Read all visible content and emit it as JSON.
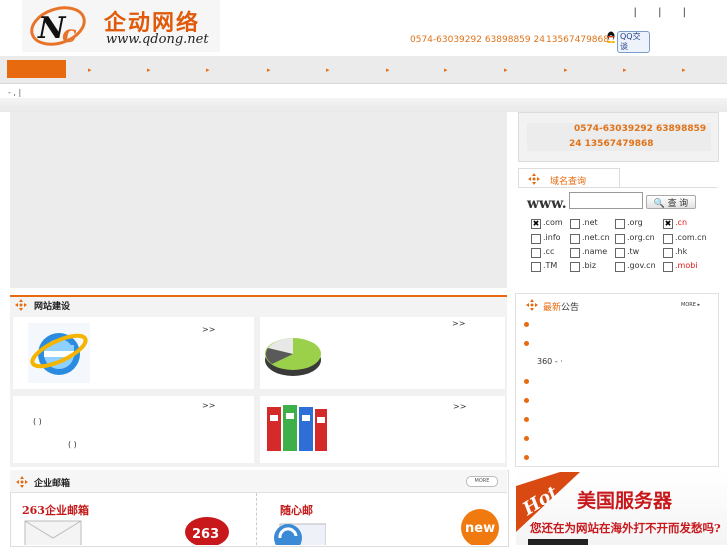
{
  "header": {
    "logo_cn": "企动网络",
    "logo_url": "www.qdong.net",
    "top_links": "| | |",
    "phone_line1": "0574-63039292 63898859 24",
    "phone_line2": "13567479868",
    "qq_label": "QQ交谈"
  },
  "nav": {
    "items": [
      "",
      "",
      "",
      "",
      "",
      "",
      "",
      "",
      "",
      "",
      "",
      ""
    ]
  },
  "breadcrumb": "- ,       |",
  "contact_box": {
    "line1": "0574-63039292 63898859",
    "line2": "24          13567479868"
  },
  "domain_search": {
    "title": "域名查询",
    "prefix": "www.",
    "input_value": "",
    "button_label": "查 询",
    "extensions": [
      {
        "label": ".com",
        "checked": true,
        "color": "#333333"
      },
      {
        "label": ".net",
        "checked": false,
        "color": "#333333"
      },
      {
        "label": ".org",
        "checked": false,
        "color": "#333333"
      },
      {
        "label": ".cn",
        "checked": true,
        "color": "#e01818"
      },
      {
        "label": ".info",
        "checked": false,
        "color": "#333333"
      },
      {
        "label": ".net.cn",
        "checked": false,
        "color": "#333333"
      },
      {
        "label": ".org.cn",
        "checked": false,
        "color": "#333333"
      },
      {
        "label": ".com.cn",
        "checked": false,
        "color": "#333333"
      },
      {
        "label": ".cc",
        "checked": false,
        "color": "#333333"
      },
      {
        "label": ".name",
        "checked": false,
        "color": "#333333"
      },
      {
        "label": ".tw",
        "checked": false,
        "color": "#333333"
      },
      {
        "label": ".hk",
        "checked": false,
        "color": "#333333"
      },
      {
        "label": ".TM",
        "checked": false,
        "color": "#333333"
      },
      {
        "label": ".biz",
        "checked": false,
        "color": "#333333"
      },
      {
        "label": ".gov.cn",
        "checked": false,
        "color": "#333333"
      },
      {
        "label": ".mobi",
        "checked": false,
        "color": "#e01818"
      }
    ]
  },
  "web_section": {
    "title": "网站建设",
    "more": ">>",
    "card3_note1": "(     )",
    "card3_note2": "(   )"
  },
  "news": {
    "title_accent": "最新",
    "title_rest": "公告",
    "more": "MORE",
    "item_360": "360     -  ·"
  },
  "mail_section": {
    "title": "企业邮箱",
    "more": "MORE",
    "mail263": "263企业邮箱",
    "mailsxy": "随心邮",
    "new_badge": "new",
    "logo263": "263"
  },
  "hot_banner": {
    "hot": "Hot",
    "title": "美国服务器",
    "subtitle": "您还在为网站在海外打不开而发愁吗?"
  },
  "colors": {
    "accent": "#e86a0f",
    "red": "#c8181c"
  }
}
